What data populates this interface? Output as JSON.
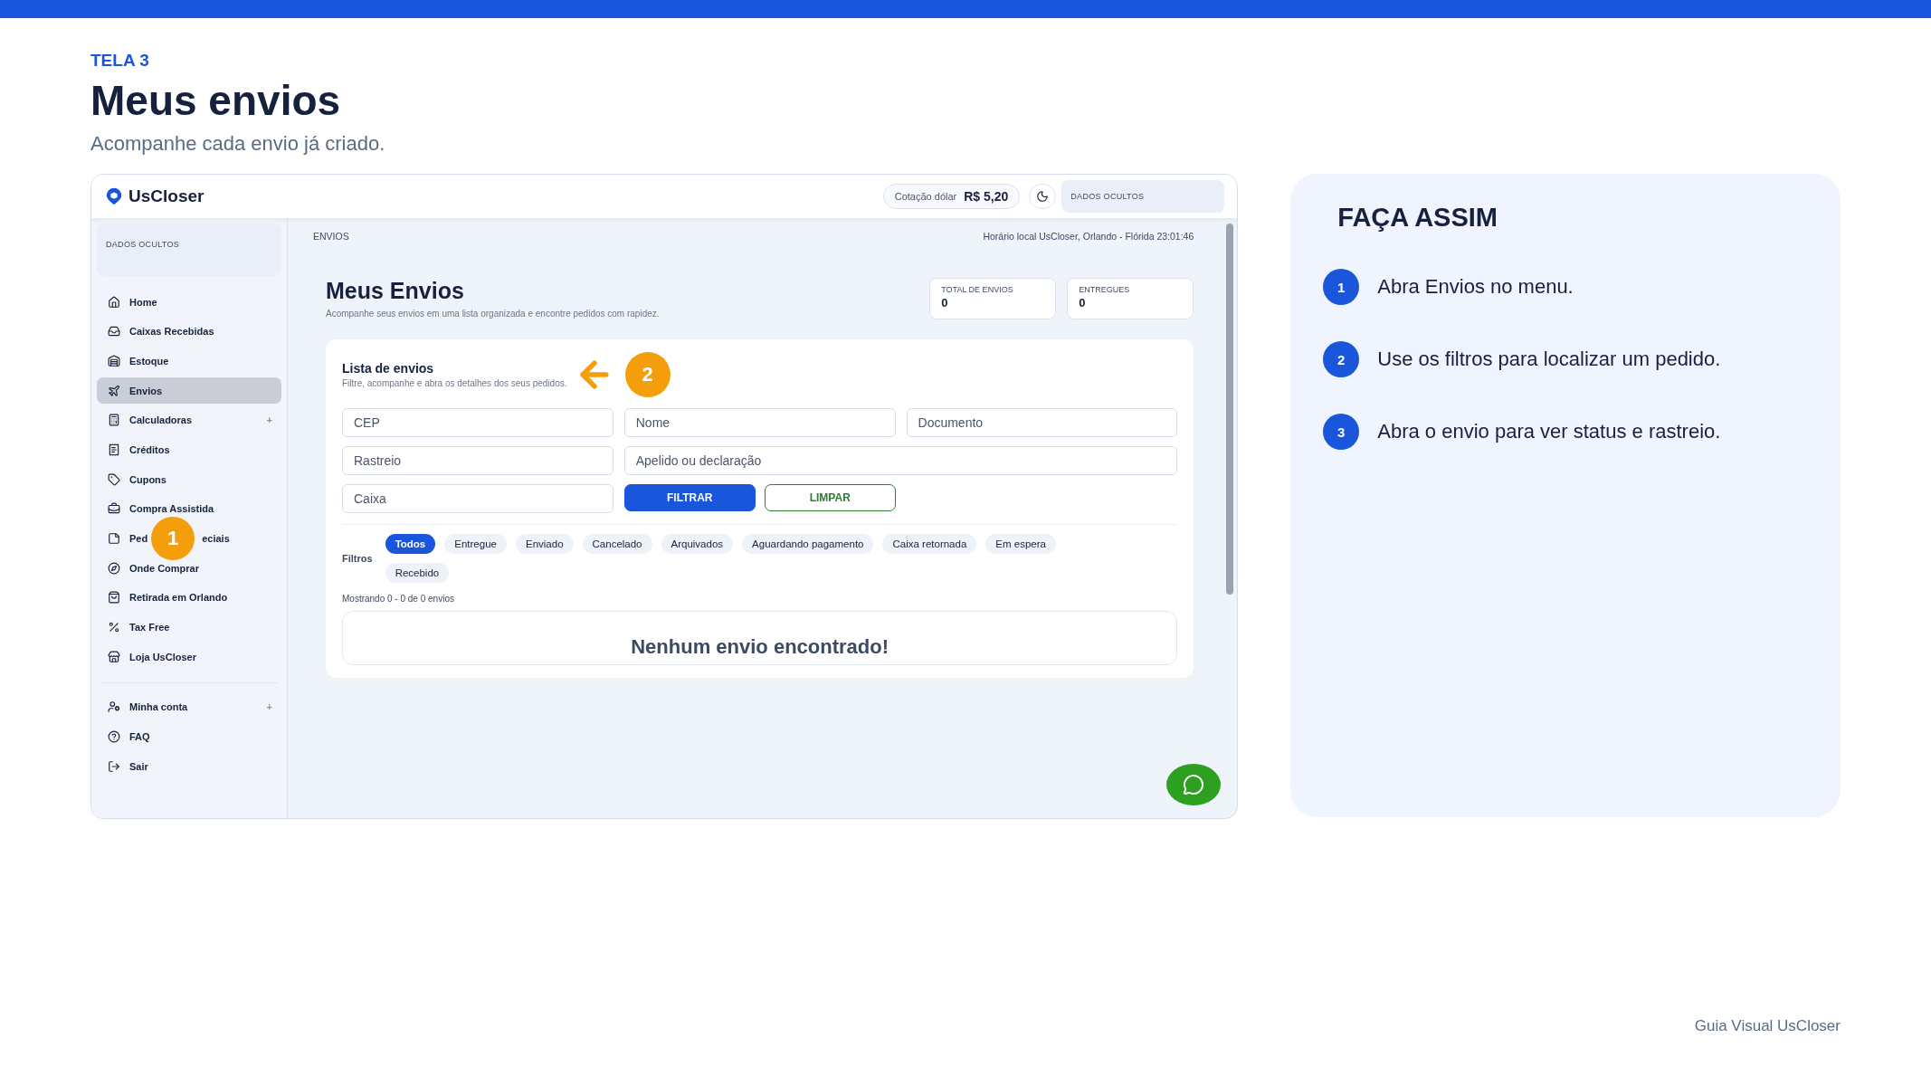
{
  "slide": {
    "eyebrow": "TELA 3",
    "title": "Meus envios",
    "subtitle": "Acompanhe cada envio já criado.",
    "footer": "Guia Visual UsCloser"
  },
  "app": {
    "brand": "UsCloser",
    "rate_label": "Cotação dólar",
    "rate_value": "R$ 5,20",
    "user_hidden": "DADOS OCULTOS",
    "sidebar_hidden": "DADOS OCULTOS",
    "breadcrumb": "ENVIOS",
    "clock": "Horário local UsCloser, Orlando - Flórida 23:01:46",
    "page_title": "Meus Envios",
    "page_subtitle": "Acompanhe seus envios em uma lista organizada e encontre pedidos com rapidez.",
    "stats": [
      {
        "label": "TOTAL DE ENVIOS",
        "value": "0"
      },
      {
        "label": "ENTREGUES",
        "value": "0"
      }
    ],
    "sidebar": {
      "items": [
        {
          "label": "Home",
          "selected": false
        },
        {
          "label": "Caixas Recebidas",
          "selected": false
        },
        {
          "label": "Estoque",
          "selected": false
        },
        {
          "label": "Envios",
          "selected": true
        },
        {
          "label": "Calculadoras",
          "selected": false,
          "expander": "+"
        },
        {
          "label": "Créditos",
          "selected": false
        },
        {
          "label": "Cupons",
          "selected": false
        },
        {
          "label": "Compra Assistida",
          "selected": false
        },
        {
          "label_parts": [
            "Ped",
            "eciais"
          ],
          "selected": false,
          "callout": "1"
        },
        {
          "label": "Onde Comprar",
          "selected": false
        },
        {
          "label": "Retirada em Orlando",
          "selected": false
        },
        {
          "label": "Tax Free",
          "selected": false
        },
        {
          "label": "Loja UsCloser",
          "selected": false
        }
      ],
      "bottom_items": [
        {
          "label": "Minha conta",
          "selected": false,
          "expander": "+"
        },
        {
          "label": "FAQ",
          "selected": false
        },
        {
          "label": "Sair",
          "selected": false
        }
      ]
    },
    "card": {
      "title": "Lista de envios",
      "subtitle": "Filtre, acompanhe e abra os detalhes dos seus pedidos.",
      "callout": "2",
      "fields": [
        {
          "placeholder": "CEP",
          "wide": false
        },
        {
          "placeholder": "Nome",
          "wide": false
        },
        {
          "placeholder": "Documento",
          "wide": false
        },
        {
          "placeholder": "Rastreio",
          "wide": false
        },
        {
          "placeholder": "Apelido ou declaração",
          "wide": true
        },
        {
          "placeholder": "Caixa",
          "wide": false
        }
      ],
      "buttons": [
        {
          "label": "FILTRAR",
          "kind": "primary"
        },
        {
          "label": "LIMPAR",
          "kind": "outline"
        }
      ],
      "filters_label": "Filtros",
      "chips": [
        {
          "label": "Todos",
          "selected": true
        },
        {
          "label": "Entregue",
          "selected": false
        },
        {
          "label": "Enviado",
          "selected": false
        },
        {
          "label": "Cancelado",
          "selected": false
        },
        {
          "label": "Arquivados",
          "selected": false
        },
        {
          "label": "Aguardando pagamento",
          "selected": false
        },
        {
          "label": "Caixa retornada",
          "selected": false
        },
        {
          "label": "Em espera",
          "selected": false
        },
        {
          "label": "Recebido",
          "selected": false
        }
      ],
      "showing": "Mostrando 0 - 0 de 0 envios",
      "empty": "Nenhum envio encontrado!"
    }
  },
  "steps_panel": {
    "title": "FAÇA ASSIM",
    "steps": [
      {
        "number": "1",
        "text": "Abra Envios no menu."
      },
      {
        "number": "2",
        "text": "Use os filtros para localizar um pedido."
      },
      {
        "number": "3",
        "text": "Abra o envio para ver status e rastreio."
      }
    ]
  }
}
